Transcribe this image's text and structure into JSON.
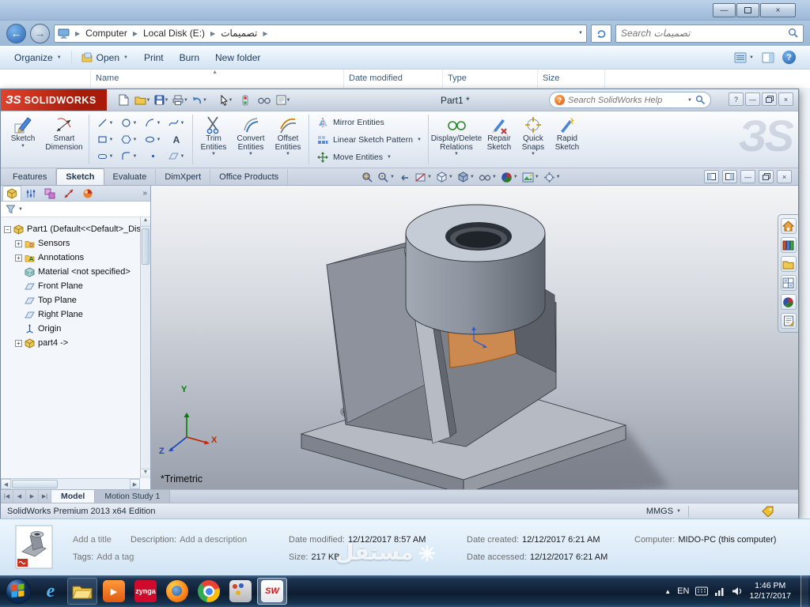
{
  "icons": {
    "caret_down": "▼",
    "caret_up": "▲",
    "breadcrumb_sep": "▶",
    "sort_asc": "▲",
    "minimize": "—",
    "close": "×",
    "back": "←",
    "forward": "→",
    "help": "?",
    "chevron_double": "»",
    "plus": "+",
    "minus": "−",
    "ie": "e",
    "play": "▶",
    "sw_badge": "SW",
    "ds_logo": "ЗS",
    "tab_first": "|◀",
    "tab_prev": "◀",
    "tab_next": "▶",
    "tab_last": "▶|"
  },
  "explorer": {
    "breadcrumb": [
      "Computer",
      "Local Disk (E:)",
      "تصميمات"
    ],
    "search_placeholder": "Search تصميمات",
    "toolbar": {
      "organize": "Organize",
      "open": "Open",
      "print": "Print",
      "burn": "Burn",
      "new_folder": "New folder"
    },
    "columns": {
      "name": "Name",
      "date_modified": "Date modified",
      "type": "Type",
      "size": "Size"
    },
    "details": {
      "title_placeholder": "Add a title",
      "description_label": "Description:",
      "description_placeholder": "Add a description",
      "tags_label": "Tags:",
      "tags_placeholder": "Add a tag",
      "date_modified_label": "Date modified:",
      "date_modified": "12/12/2017 8:57 AM",
      "size_label": "Size:",
      "size": "217 KB",
      "date_created_label": "Date created:",
      "date_created": "12/12/2017 6:21 AM",
      "date_accessed_label": "Date accessed:",
      "date_accessed": "12/12/2017 6:21 AM",
      "computer_label": "Computer:",
      "computer": "MIDO-PC (this computer)"
    }
  },
  "solidworks": {
    "brand": "SOLIDWORKS",
    "doc_title": "Part1 *",
    "help_search_placeholder": "Search SolidWorks Help",
    "tabs": [
      "Features",
      "Sketch",
      "Evaluate",
      "DimXpert",
      "Office Products"
    ],
    "ribbon": {
      "sketch": "Sketch",
      "smart_dimension": "Smart Dimension",
      "trim": "Trim Entities",
      "convert": "Convert Entities",
      "offset": "Offset Entities",
      "mirror": "Mirror Entities",
      "linear_pattern": "Linear Sketch Pattern",
      "move": "Move Entities",
      "display_delete": "Display/Delete Relations",
      "repair": "Repair Sketch",
      "quick_snaps": "Quick Snaps",
      "rapid": "Rapid Sketch",
      "text_tool": "A"
    },
    "tree": {
      "root": "Part1 (Default<<Default>_Disp",
      "items": [
        "Sensors",
        "Annotations",
        "Material <not specified>",
        "Front Plane",
        "Top Plane",
        "Right Plane",
        "Origin",
        "part4 ->"
      ]
    },
    "triad": {
      "x": "X",
      "y": "Y",
      "z": "Z"
    },
    "view_label": "*Trimetric",
    "bottom_tabs": [
      "Model",
      "Motion Study 1"
    ],
    "status": "SolidWorks Premium 2013 x64 Edition",
    "units": "MMGS"
  },
  "taskbar": {
    "zynga": "zynga",
    "tray": {
      "lang": "EN",
      "time": "1:46 PM",
      "date": "12/17/2017"
    }
  },
  "watermark": "مستقل"
}
